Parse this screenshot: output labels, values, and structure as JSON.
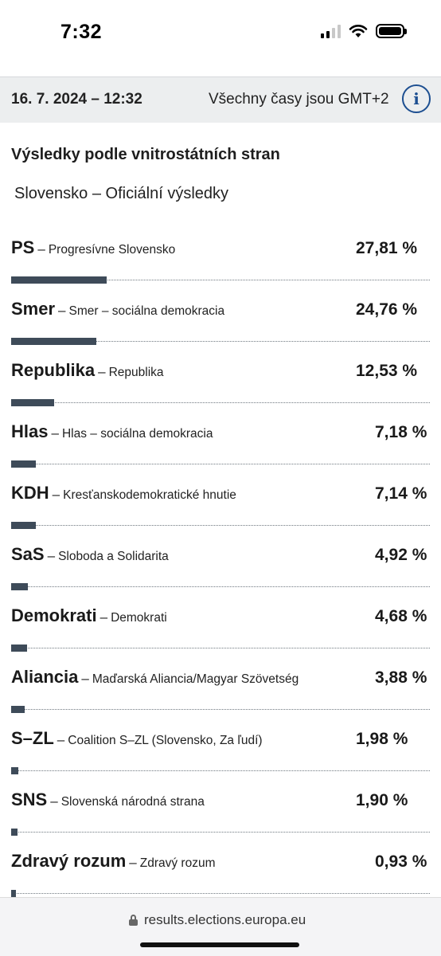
{
  "status_bar": {
    "time": "7:32"
  },
  "header": {
    "date": "16. 7. 2024 – 12:32",
    "timezone": "Všechny časy jsou GMT+2"
  },
  "results": {
    "title": "Výsledky podle vnitrostátních stran",
    "subtitle": "Slovensko – Oficiální výsledky",
    "dash": "–",
    "parties": [
      {
        "abbr": "PS",
        "full": "Progresívne Slovensko",
        "percent": "27,81 %",
        "value": 27.81
      },
      {
        "abbr": "Smer",
        "full": "Smer – sociálna demokracia",
        "percent": "24,76 %",
        "value": 24.76
      },
      {
        "abbr": "Republika",
        "full": "Republika",
        "percent": "12,53 %",
        "value": 12.53
      },
      {
        "abbr": "Hlas",
        "full": "Hlas – sociálna demokracia",
        "percent": "7,18 %",
        "value": 7.18
      },
      {
        "abbr": "KDH",
        "full": "Kresťanskodemokratické hnutie",
        "percent": "7,14 %",
        "value": 7.14
      },
      {
        "abbr": "SaS",
        "full": "Sloboda a Solidarita",
        "percent": "4,92 %",
        "value": 4.92
      },
      {
        "abbr": "Demokrati",
        "full": "Demokrati",
        "percent": "4,68 %",
        "value": 4.68
      },
      {
        "abbr": "Aliancia",
        "full": "Maďarská Aliancia/Magyar Szövetség",
        "percent": "3,88 %",
        "value": 3.88
      },
      {
        "abbr": "S–ZL",
        "full": "Coalition S–ZL (Slovensko, Za ľudí)",
        "percent": "1,98 %",
        "value": 1.98
      },
      {
        "abbr": "SNS",
        "full": "Slovenská národná strana",
        "percent": "1,90 %",
        "value": 1.9
      },
      {
        "abbr": "Zdravý rozum",
        "full": "Zdravý rozum",
        "percent": "0,93 %",
        "value": 0.93
      }
    ]
  },
  "browser": {
    "url": "results.elections.europa.eu"
  },
  "icons": {
    "info": "info-icon",
    "lock": "lock-icon",
    "signal": "cellular-signal-icon",
    "wifi": "wifi-icon",
    "battery": "battery-icon"
  },
  "colors": {
    "bar": "#3e4b59",
    "info_accent": "#1d4f91",
    "date_bar_bg": "#eceeef"
  }
}
